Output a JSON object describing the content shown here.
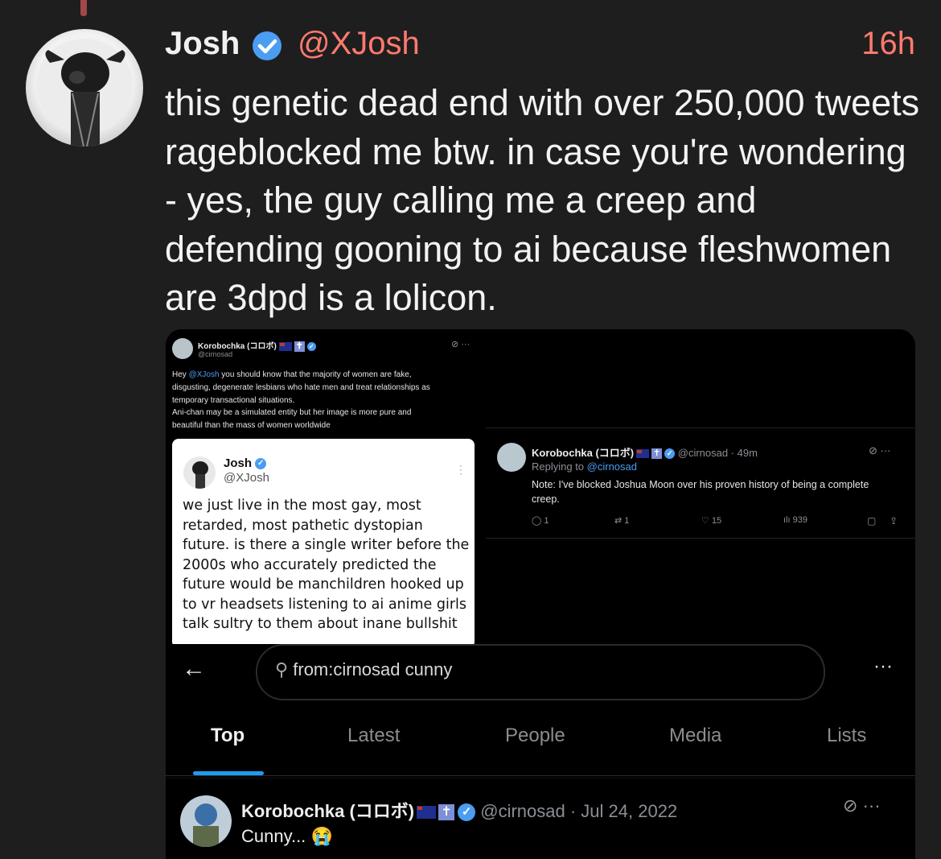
{
  "post": {
    "author_name": "Josh",
    "author_handle": "@XJosh",
    "time": "16h",
    "text": "this genetic dead end with over 250,000 tweets rageblocked me btw. in case you're wondering - yes, the guy calling me a creep and defending gooning to ai because fleshwomen are 3dpd is a lolicon."
  },
  "shot1": {
    "name": "Korobochka (コロボ)",
    "handle": "@cirnosad",
    "text_line1_pre": "Hey ",
    "text_mention": "@XJosh",
    "text_line1_post": " you should know that the majority of women are fake,",
    "text_line2": "disgusting, degenerate lesbians who hate men and treat relationships as",
    "text_line3": "temporary transactional situations.",
    "text_line4": "Ani-chan may be a simulated entity but her image is more pure and",
    "text_line5": "beautiful than the mass of women worldwide",
    "quote": {
      "name": "Josh",
      "handle": "@XJosh",
      "lines": [
        "we just live in the most gay, most",
        "retarded, most pathetic dystopian",
        "future. is there a single writer before the",
        "2000s who accurately predicted the",
        "future would be manchildren hooked up",
        "to vr headsets listening to ai anime girls",
        "talk sultry to them about inane bullshit"
      ]
    }
  },
  "shot2": {
    "name": "Korobochka (コロボ)",
    "handle_time": "@cirnosad · 49m",
    "replying_prefix": "Replying to ",
    "replying_handle": "@cirnosad",
    "text_line1": "Note: I've blocked Joshua Moon over his proven history of being a complete",
    "text_line2": "creep.",
    "replies": "1",
    "retweets": "1",
    "likes": "15",
    "views": "939"
  },
  "shot3": {
    "search_value": "from:cirnosad cunny",
    "tabs": [
      "Top",
      "Latest",
      "People",
      "Media",
      "Lists"
    ],
    "active_tab": "Top",
    "result_name": "Korobochka (コロボ)",
    "result_handle_date": "@cirnosad · Jul 24, 2022",
    "result_text": "Cunny...",
    "result_emoji": "😭"
  },
  "colors": {
    "background": "#1e1e1f",
    "accent": "#ff7a6e",
    "verified": "#4a9df1",
    "tab_indicator": "#1d9bf0"
  },
  "icons": [
    "verified-badge-icon",
    "grok-icon",
    "more-icon",
    "reply-icon",
    "retweet-icon",
    "like-icon",
    "views-icon",
    "bookmark-icon",
    "share-icon",
    "back-arrow-icon",
    "search-icon"
  ]
}
